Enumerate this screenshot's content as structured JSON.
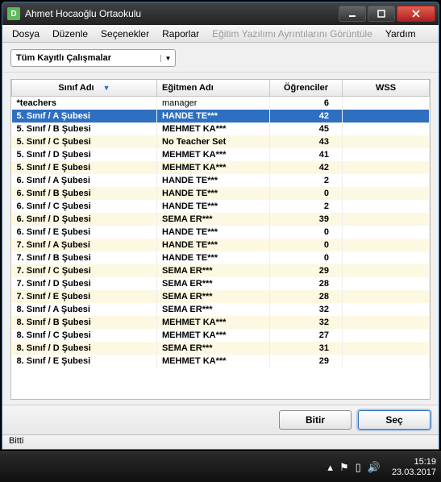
{
  "window": {
    "title": "Ahmet Hocaoğlu Ortaokulu"
  },
  "menu": {
    "file": "Dosya",
    "edit": "Düzenle",
    "options": "Seçenekler",
    "reports": "Raporlar",
    "details": "Eğitim Yazılımı Ayrıntılarını Görüntüle",
    "help": "Yardım"
  },
  "toolbar": {
    "filter_label": "Tüm Kayıtlı Çalışmalar"
  },
  "columns": {
    "class": "Sınıf Adı",
    "teacher": "Eğitmen Adı",
    "students": "Öğrenciler",
    "wss": "WSS"
  },
  "rows": [
    {
      "class": "*teachers",
      "teacher": "manager",
      "students": "6",
      "selected": false,
      "tBold": false
    },
    {
      "class": "5. Sınıf / A Şubesi",
      "teacher": "HANDE TE***",
      "students": "42",
      "selected": true,
      "tBold": true
    },
    {
      "class": "5. Sınıf / B Şubesi",
      "teacher": "MEHMET KA***",
      "students": "45",
      "selected": false,
      "tBold": true
    },
    {
      "class": "5. Sınıf / C Şubesi",
      "teacher": "No Teacher Set",
      "students": "43",
      "selected": false,
      "tBold": true
    },
    {
      "class": "5. Sınıf / D Şubesi",
      "teacher": "MEHMET KA***",
      "students": "41",
      "selected": false,
      "tBold": true
    },
    {
      "class": "5. Sınıf / E Şubesi",
      "teacher": "MEHMET KA***",
      "students": "42",
      "selected": false,
      "tBold": true
    },
    {
      "class": "6. Sınıf / A Şubesi",
      "teacher": "HANDE TE***",
      "students": "2",
      "selected": false,
      "tBold": true
    },
    {
      "class": "6. Sınıf / B Şubesi",
      "teacher": "HANDE TE***",
      "students": "0",
      "selected": false,
      "tBold": true
    },
    {
      "class": "6. Sınıf / C Şubesi",
      "teacher": "HANDE TE***",
      "students": "2",
      "selected": false,
      "tBold": true
    },
    {
      "class": "6. Sınıf / D Şubesi",
      "teacher": "SEMA ER***",
      "students": "39",
      "selected": false,
      "tBold": true
    },
    {
      "class": "6. Sınıf / E Şubesi",
      "teacher": "HANDE TE***",
      "students": "0",
      "selected": false,
      "tBold": true
    },
    {
      "class": "7. Sınıf / A Şubesi",
      "teacher": "HANDE TE***",
      "students": "0",
      "selected": false,
      "tBold": true
    },
    {
      "class": "7. Sınıf / B Şubesi",
      "teacher": "HANDE TE***",
      "students": "0",
      "selected": false,
      "tBold": true
    },
    {
      "class": "7. Sınıf / C Şubesi",
      "teacher": "SEMA ER***",
      "students": "29",
      "selected": false,
      "tBold": true
    },
    {
      "class": "7. Sınıf / D Şubesi",
      "teacher": "SEMA ER***",
      "students": "28",
      "selected": false,
      "tBold": true
    },
    {
      "class": "7. Sınıf / E Şubesi",
      "teacher": "SEMA ER***",
      "students": "28",
      "selected": false,
      "tBold": true
    },
    {
      "class": "8. Sınıf / A Şubesi",
      "teacher": "SEMA ER***",
      "students": "32",
      "selected": false,
      "tBold": true
    },
    {
      "class": "8. Sınıf / B Şubesi",
      "teacher": "MEHMET KA***",
      "students": "32",
      "selected": false,
      "tBold": true
    },
    {
      "class": "8. Sınıf / C Şubesi",
      "teacher": "MEHMET KA***",
      "students": "27",
      "selected": false,
      "tBold": true
    },
    {
      "class": "8. Sınıf / D Şubesi",
      "teacher": "SEMA ER***",
      "students": "31",
      "selected": false,
      "tBold": true
    },
    {
      "class": "8. Sınıf / E Şubesi",
      "teacher": "MEHMET KA***",
      "students": "29",
      "selected": false,
      "tBold": true
    }
  ],
  "buttons": {
    "finish": "Bitir",
    "select": "Seç"
  },
  "status": {
    "text": "Bitti"
  },
  "tray": {
    "time": "15:19",
    "date": "23.03.2017"
  }
}
